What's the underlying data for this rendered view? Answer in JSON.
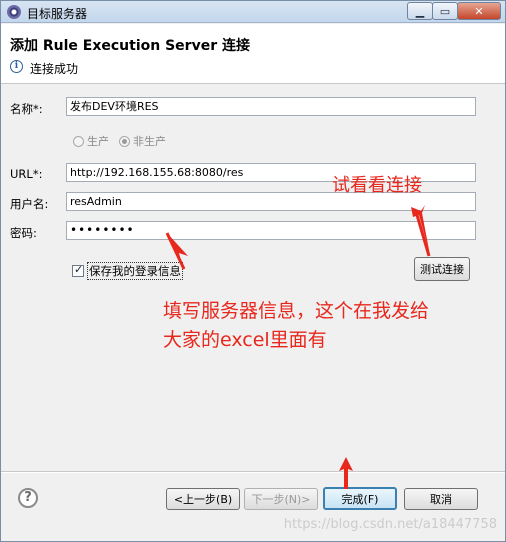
{
  "window": {
    "title": "目标服务器"
  },
  "header": {
    "title": "添加 Rule Execution Server 连接",
    "message": "连接成功"
  },
  "form": {
    "name_label": "名称*:",
    "name_value": "发布DEV环境RES",
    "radio_production": "生产",
    "radio_nonproduction": "非生产",
    "radio_selected": "非生产",
    "url_label": "URL*:",
    "url_value": "http://192.168.155.68:8080/res",
    "user_label": "用户名:",
    "user_value": "resAdmin",
    "password_label": "密码:",
    "password_value": "••••••••",
    "save_login_label": "保存我的登录信息",
    "save_login_checked": true,
    "test_button": "测试连接"
  },
  "footer": {
    "back_button": "<上一步(B)",
    "next_button": "下一步(N)>",
    "finish_button": "完成(F)",
    "cancel_button": "取消"
  },
  "annotations": {
    "try_connect": "试看看连接",
    "fill_info_line1": "填写服务器信息，这个在我发给",
    "fill_info_line2": "大家的excel里面有",
    "color": "#e8271d"
  },
  "watermark": "https://blog.csdn.net/a18447758"
}
